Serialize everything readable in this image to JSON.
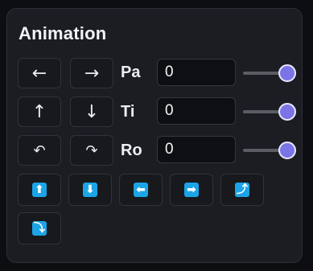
{
  "panel": {
    "title": "Animation"
  },
  "move_buttons": {
    "left": "←",
    "right": "→",
    "up": "↑",
    "down": "↓",
    "rotate_ccw": "↶",
    "rotate_cw": "↷"
  },
  "rows": [
    {
      "label": "Pa",
      "value": "0",
      "slider_fraction": 1.0
    },
    {
      "label": "Ti",
      "value": "0",
      "slider_fraction": 1.0
    },
    {
      "label": "Ro",
      "value": "0",
      "slider_fraction": 1.0
    }
  ],
  "emoji_buttons": [
    {
      "glyph": "⬆",
      "icon": "up-arrow-emoji-icon"
    },
    {
      "glyph": "⬇",
      "icon": "down-arrow-emoji-icon"
    },
    {
      "glyph": "⬅",
      "icon": "left-arrow-emoji-icon"
    },
    {
      "glyph": "➡",
      "icon": "right-arrow-emoji-icon"
    },
    {
      "glyph": "⤴",
      "icon": "right-arrow-curving-up-emoji-icon"
    },
    {
      "glyph": "⤵",
      "icon": "right-arrow-curving-down-emoji-icon"
    }
  ],
  "colors": {
    "accent": "#7b74e6",
    "emoji_blue": "#1ba4e6",
    "panel_bg": "#1b1d22"
  }
}
